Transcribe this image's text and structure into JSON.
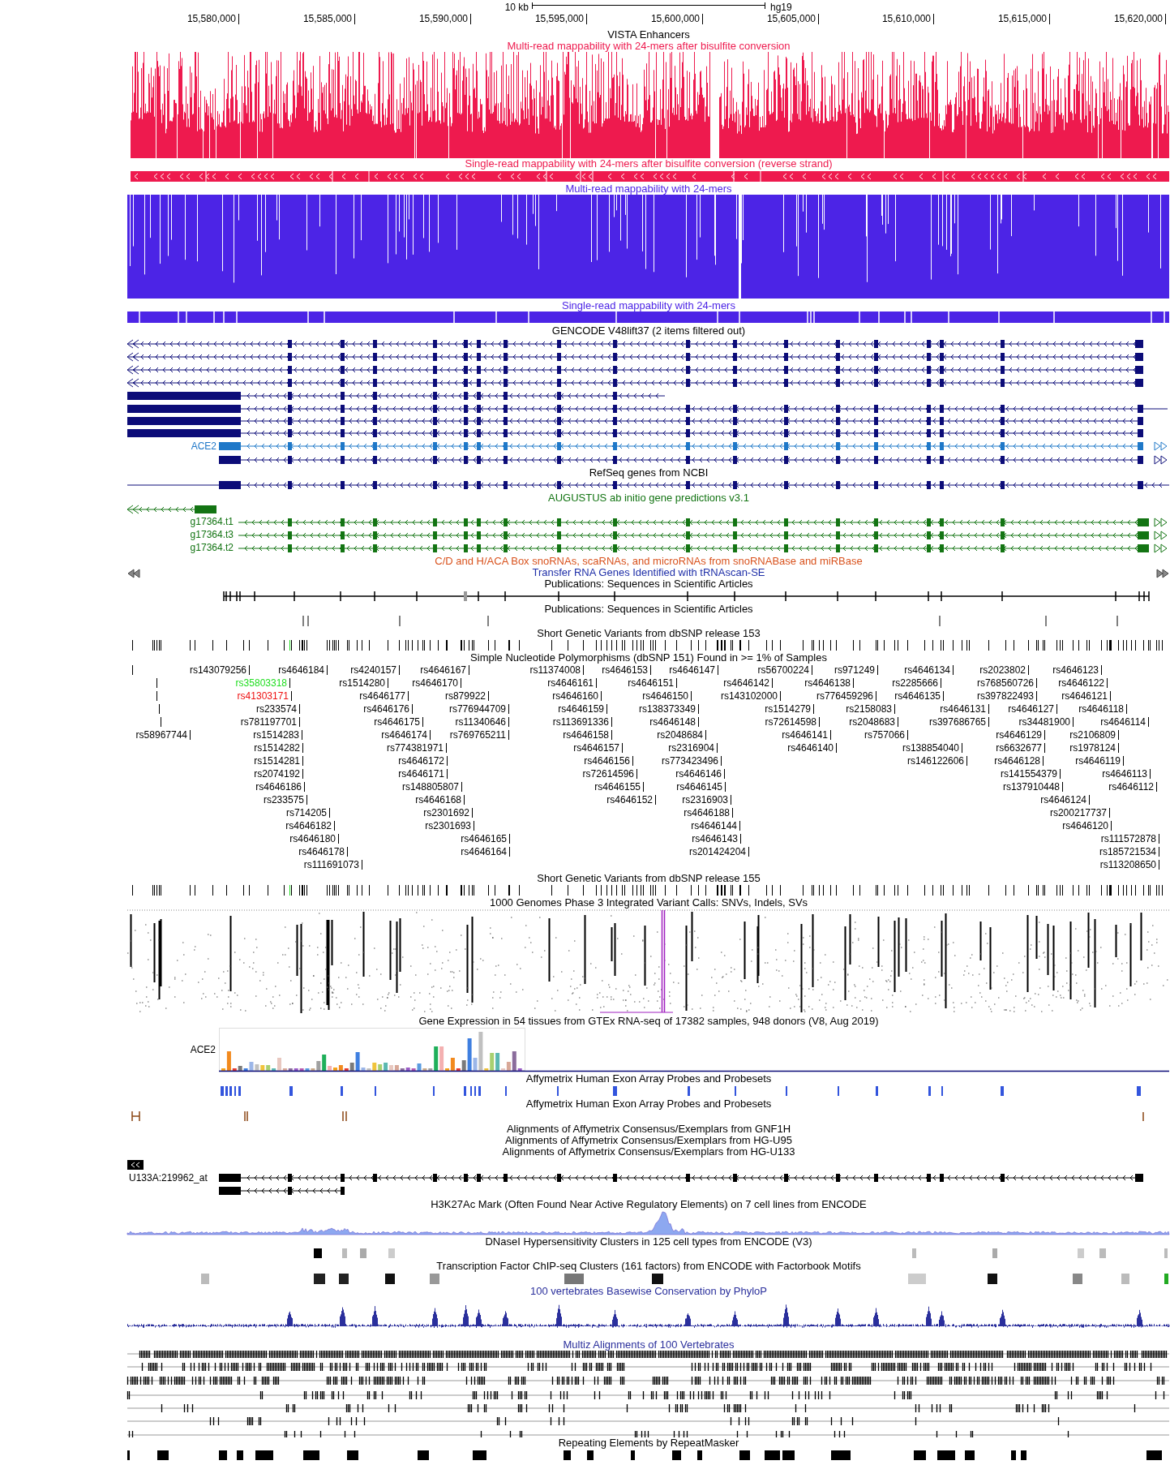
{
  "ruler": {
    "scale_label": "10 kb",
    "assembly": "hg19",
    "positions": [
      "15,580,000",
      "15,585,000",
      "15,590,000",
      "15,595,000",
      "15,600,000",
      "15,605,000",
      "15,610,000",
      "15,615,000",
      "15,620,000"
    ]
  },
  "tracks": [
    {
      "kind": "empty",
      "title": "VISTA Enhancers",
      "color": "#000000"
    },
    {
      "kind": "mappability",
      "title": "Multi-read mappability with 24-mers after bisulfite conversion",
      "color": "#ee1a4e"
    },
    {
      "kind": "strand-strip",
      "title": "Single-read mappability with 24-mers after bisulfite conversion (reverse strand)",
      "color": "#ee1a4e"
    },
    {
      "kind": "mappability-full",
      "title": "Multi-read mappability with 24-mers",
      "color": "#4c24e6"
    },
    {
      "kind": "bar-strip",
      "title": "Single-read mappability with 24-mers",
      "color": "#4c24e6"
    },
    {
      "kind": "gencode",
      "title": "GENCODE V48lift37 (2 items filtered out)",
      "color": "#000000",
      "gene_label": "ACE2"
    },
    {
      "kind": "refseq",
      "title": "RefSeq genes from NCBI",
      "color": "#000000"
    },
    {
      "kind": "augustus",
      "title": "AUGUSTUS ab initio gene predictions v3.1",
      "color": "#137413",
      "labels": [
        "g17364.t1",
        "g17364.t3",
        "g17364.t2"
      ]
    },
    {
      "kind": "empty",
      "title": "C/D and H/ACA Box snoRNAs, scaRNAs, and microRNAs from snoRNABase and miRBase",
      "color": "#d9531e"
    },
    {
      "kind": "trna",
      "title": "Transfer RNA Genes Identified with tRNAscan-SE",
      "color": "#1f2fa8"
    },
    {
      "kind": "publications",
      "title": "Publications: Sequences in Scientific Articles",
      "color": "#000000"
    },
    {
      "kind": "publications-2",
      "title": "Publications: Sequences in Scientific Articles",
      "color": "#000000"
    },
    {
      "kind": "variant-ticks",
      "title": "Short Genetic Variants from dbSNP release 153",
      "color": "#000000"
    },
    {
      "kind": "snp-labels",
      "title": "Simple Nucleotide Polymorphisms (dbSNP 151) Found in >= 1% of Samples",
      "color": "#000000",
      "labels": [
        {
          "label": "rs143079256"
        },
        {
          "label": "rs4646184"
        },
        {
          "label": "rs4240157"
        },
        {
          "label": "rs4646167"
        },
        {
          "label": "rs11374008"
        },
        {
          "label": "rs4646153"
        },
        {
          "label": "rs4646147"
        },
        {
          "label": "rs56700224"
        },
        {
          "label": "rs971249"
        },
        {
          "label": "rs4646134"
        },
        {
          "label": "rs2023802"
        },
        {
          "label": "rs4646123"
        },
        {
          "label": "rs35803318",
          "color": "#1fdd1f"
        },
        {
          "label": "rs1514280"
        },
        {
          "label": "rs4646170"
        },
        {
          "label": "rs4646161"
        },
        {
          "label": "rs4646151"
        },
        {
          "label": "rs4646142"
        },
        {
          "label": "rs4646138"
        },
        {
          "label": "rs2285666"
        },
        {
          "label": "rs768560726"
        },
        {
          "label": "rs4646122"
        },
        {
          "label": "rs41303171",
          "color": "#ee1111"
        },
        {
          "label": "rs4646177"
        },
        {
          "label": "rs879922"
        },
        {
          "label": "rs4646160"
        },
        {
          "label": "rs4646150"
        },
        {
          "label": "rs143102000"
        },
        {
          "label": "rs776459296"
        },
        {
          "label": "rs4646135"
        },
        {
          "label": "rs397822493"
        },
        {
          "label": "rs4646121"
        },
        {
          "label": "rs233574"
        },
        {
          "label": "rs4646176"
        },
        {
          "label": "rs776944709"
        },
        {
          "label": "rs4646159"
        },
        {
          "label": "rs138373349"
        },
        {
          "label": "rs1514279"
        },
        {
          "label": "rs2158083"
        },
        {
          "label": "rs4646131"
        },
        {
          "label": "rs4646127"
        },
        {
          "label": "rs4646118"
        },
        {
          "label": "rs781197701"
        },
        {
          "label": "rs4646175"
        },
        {
          "label": "rs11340646"
        },
        {
          "label": "rs113691336"
        },
        {
          "label": "rs4646148"
        },
        {
          "label": "rs72614598"
        },
        {
          "label": "rs2048683"
        },
        {
          "label": "rs397686765"
        },
        {
          "label": "rs34481900"
        },
        {
          "label": "rs4646114"
        },
        {
          "label": "rs58967744"
        },
        {
          "label": "rs1514283"
        },
        {
          "label": "rs4646174"
        },
        {
          "label": "rs769765211"
        },
        {
          "label": "rs4646158"
        },
        {
          "label": "rs2048684"
        },
        {
          "label": "rs4646141"
        },
        {
          "label": "rs757066"
        },
        {
          "label": "rs4646129"
        },
        {
          "label": "rs2106809"
        },
        {
          "label": "rs1514282"
        },
        {
          "label": "rs774381971"
        },
        {
          "label": "rs4646157"
        },
        {
          "label": "rs2316904"
        },
        {
          "label": "rs4646140"
        },
        {
          "label": "rs138854040"
        },
        {
          "label": "rs6632677"
        },
        {
          "label": "rs1978124"
        },
        {
          "label": "rs1514281"
        },
        {
          "label": "rs4646172"
        },
        {
          "label": "rs4646156"
        },
        {
          "label": "rs773423496"
        },
        {
          "label": "rs146122606"
        },
        {
          "label": "rs4646128"
        },
        {
          "label": "rs4646119"
        },
        {
          "label": "rs2074192"
        },
        {
          "label": "rs4646171"
        },
        {
          "label": "rs72614596"
        },
        {
          "label": "rs4646146"
        },
        {
          "label": "rs141554379"
        },
        {
          "label": "rs4646113"
        },
        {
          "label": "rs4646186"
        },
        {
          "label": "rs148805807"
        },
        {
          "label": "rs4646155"
        },
        {
          "label": "rs4646145"
        },
        {
          "label": "rs137910448"
        },
        {
          "label": "rs4646112"
        },
        {
          "label": "rs233575"
        },
        {
          "label": "rs4646168"
        },
        {
          "label": "rs4646152"
        },
        {
          "label": "rs2316903"
        },
        {
          "label": "rs4646124"
        },
        {
          "label": "rs714205"
        },
        {
          "label": "rs2301692"
        },
        {
          "label": "rs4646188"
        },
        {
          "label": "rs200217737"
        },
        {
          "label": "rs4646182"
        },
        {
          "label": "rs2301693"
        },
        {
          "label": "rs4646144"
        },
        {
          "label": "rs4646120"
        },
        {
          "label": "rs4646180"
        },
        {
          "label": "rs4646165"
        },
        {
          "label": "rs4646143"
        },
        {
          "label": "rs111572878"
        },
        {
          "label": "rs4646178"
        },
        {
          "label": "rs4646164"
        },
        {
          "label": "rs201424204"
        },
        {
          "label": "rs185721534"
        },
        {
          "label": "rs111691073"
        },
        {
          "label": "rs113208650"
        }
      ]
    },
    {
      "kind": "variant-ticks",
      "title": "Short Genetic Variants from dbSNP release 155",
      "color": "#000000"
    },
    {
      "kind": "genotypes",
      "title": "1000 Genomes Phase 3 Integrated Variant Calls: SNVs, Indels, SVs",
      "color": "#000000"
    },
    {
      "kind": "gtex",
      "title": "Gene Expression in 54 tissues from GTEx RNA-seq of 17382 samples, 948 donors (V8, Aug 2019)",
      "color": "#000000",
      "gene_label": "ACE2"
    },
    {
      "kind": "affy-exon",
      "title": "Affymetrix Human Exon Array Probes and Probesets",
      "color": "#000000"
    },
    {
      "kind": "affy-exon-2",
      "title": "Affymetrix Human Exon Array Probes and Probesets",
      "color": "#000000"
    },
    {
      "kind": "empty",
      "title": "Alignments of Affymetrix Consensus/Exemplars from GNF1H",
      "color": "#000000"
    },
    {
      "kind": "empty",
      "title": "Alignments of Affymetrix Consensus/Exemplars from HG-U95",
      "color": "#000000"
    },
    {
      "kind": "u133",
      "title": "Alignments of Affymetrix Consensus/Exemplars from HG-U133",
      "color": "#000000",
      "probe_label": "U133A:219962_at"
    },
    {
      "kind": "h3k27ac",
      "title": "H3K27Ac Mark (Often Found Near Active Regulatory Elements) on 7 cell lines from ENCODE",
      "color": "#000000"
    },
    {
      "kind": "dnase",
      "title": "DNaseI Hypersensitivity Clusters in 125 cell types from ENCODE (V3)",
      "color": "#000000"
    },
    {
      "kind": "tfbs",
      "title": "Transcription Factor ChIP-seq Clusters (161 factors) from ENCODE with Factorbook Motifs",
      "color": "#000000"
    },
    {
      "kind": "phylop",
      "title": "100 vertebrates Basewise Conservation by PhyloP",
      "color": "#2a2f9c"
    },
    {
      "kind": "multiz",
      "title": "Multiz Alignments of 100 Vertebrates",
      "color": "#2a2f9c"
    },
    {
      "kind": "repeatmasker",
      "title": "Repeating Elements by RepeatMasker",
      "color": "#000000"
    }
  ]
}
